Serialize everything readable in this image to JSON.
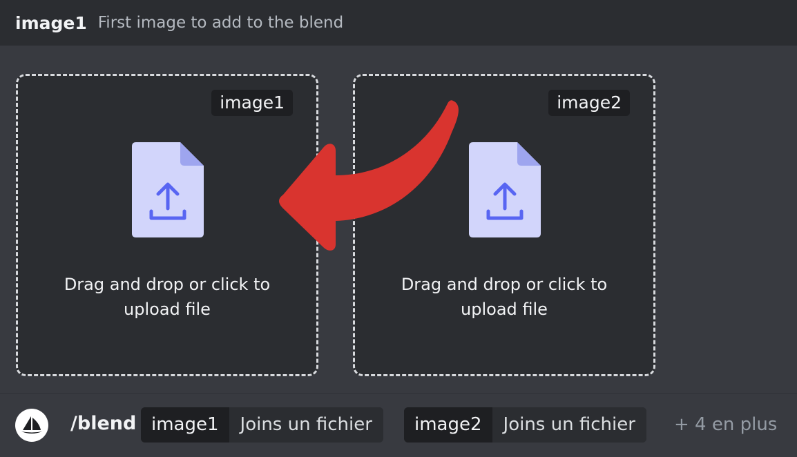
{
  "option_header": {
    "name": "image1",
    "description": "First image to add to the blend"
  },
  "dropzones": [
    {
      "tag": "image1",
      "text": "Drag and drop or click to upload file"
    },
    {
      "tag": "image2",
      "text": "Drag and drop or click to upload file"
    }
  ],
  "icons": {
    "file_upload": "file-upload-icon",
    "arrow": "curved-arrow-left-icon",
    "bot_avatar": "sailboat-logo-icon"
  },
  "colors": {
    "arrow": "#d9342f",
    "file_body": "#d2d5fb",
    "file_fold": "#9ea5ef",
    "upload_glyph": "#5865f2"
  },
  "command_bar": {
    "command": "/blend",
    "params": [
      {
        "name": "image1",
        "value": "Joins un fichier"
      },
      {
        "name": "image2",
        "value": "Joins un fichier"
      }
    ],
    "more": "+ 4 en plus"
  }
}
